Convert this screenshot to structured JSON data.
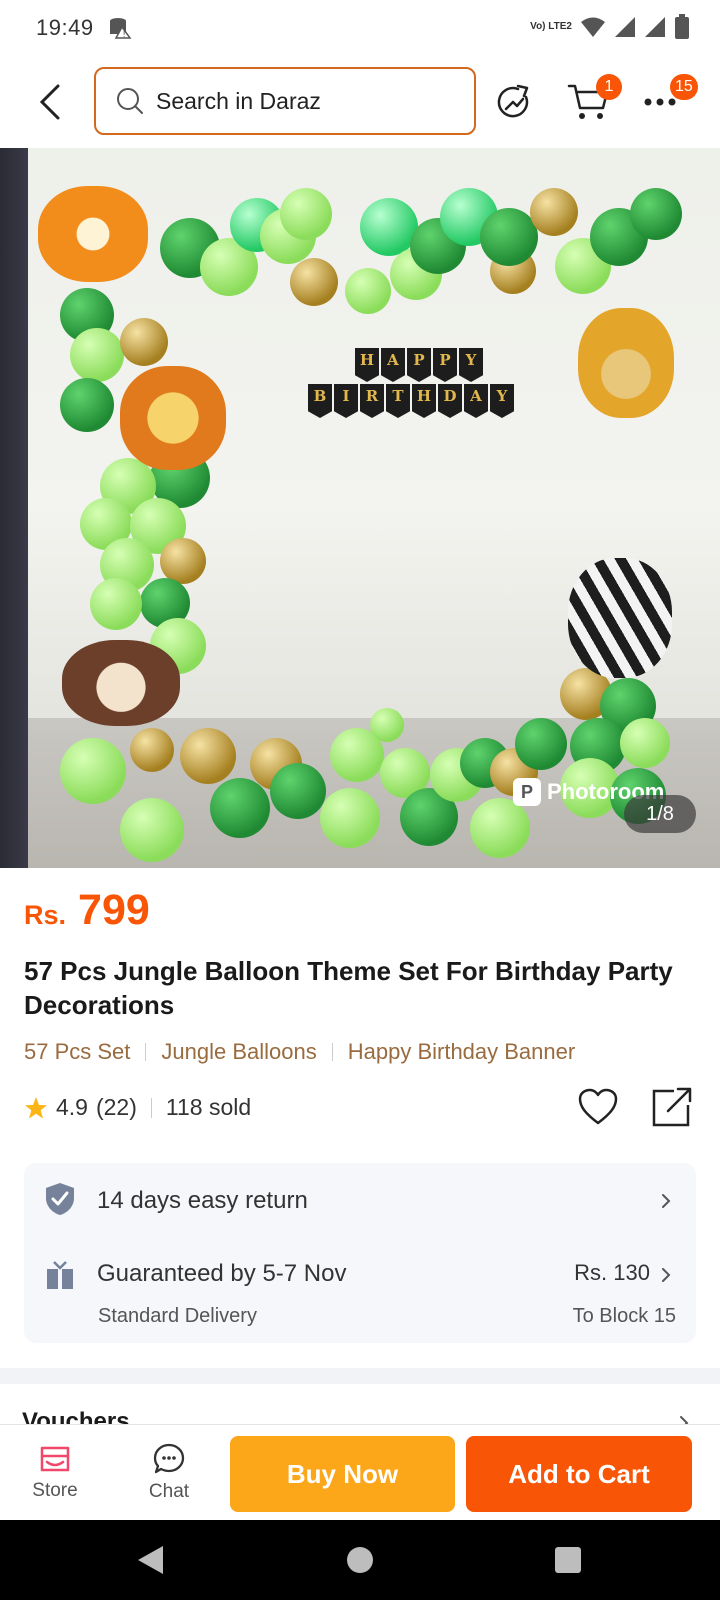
{
  "status_bar": {
    "time": "19:49",
    "network_label": "Vo) LTE2",
    "icons": [
      "storage-warning-icon",
      "wifi-icon",
      "signal-icon",
      "signal-icon",
      "battery-icon"
    ]
  },
  "header": {
    "search_placeholder": "Search in Daraz",
    "cart_badge": "1",
    "more_badge": "15",
    "icons": [
      "back-icon",
      "search-icon",
      "share-refresh-icon",
      "cart-icon",
      "more-icon"
    ]
  },
  "gallery": {
    "banner_letters_top": [
      "H",
      "A",
      "P",
      "P",
      "Y"
    ],
    "banner_letters_bottom": [
      "B",
      "I",
      "R",
      "T",
      "H",
      "D",
      "A",
      "Y"
    ],
    "watermark": "Photoroom",
    "counter": "1/8"
  },
  "product": {
    "currency": "Rs.",
    "price": "799",
    "title": "57 Pcs Jungle  Balloon Theme Set For Birthday Party Decorations",
    "tags": [
      "57 Pcs Set",
      "Jungle Balloons",
      "Happy Birthday Banner"
    ],
    "rating": "4.9",
    "reviews": "(22)",
    "sold": "118 sold"
  },
  "services": {
    "return": "14 days easy return",
    "delivery_title": "Guaranteed by 5-7 Nov",
    "delivery_type": "Standard Delivery",
    "delivery_fee": "Rs. 130",
    "delivery_to": "To Block 15"
  },
  "vouchers": {
    "title": "Vouchers"
  },
  "actions": {
    "store": "Store",
    "chat": "Chat",
    "buy_now": "Buy Now",
    "add_to_cart": "Add to Cart"
  },
  "colors": {
    "brand_orange": "#f85606",
    "buy_yellow": "#fca61a",
    "tag_brown": "#9a6b3e"
  }
}
